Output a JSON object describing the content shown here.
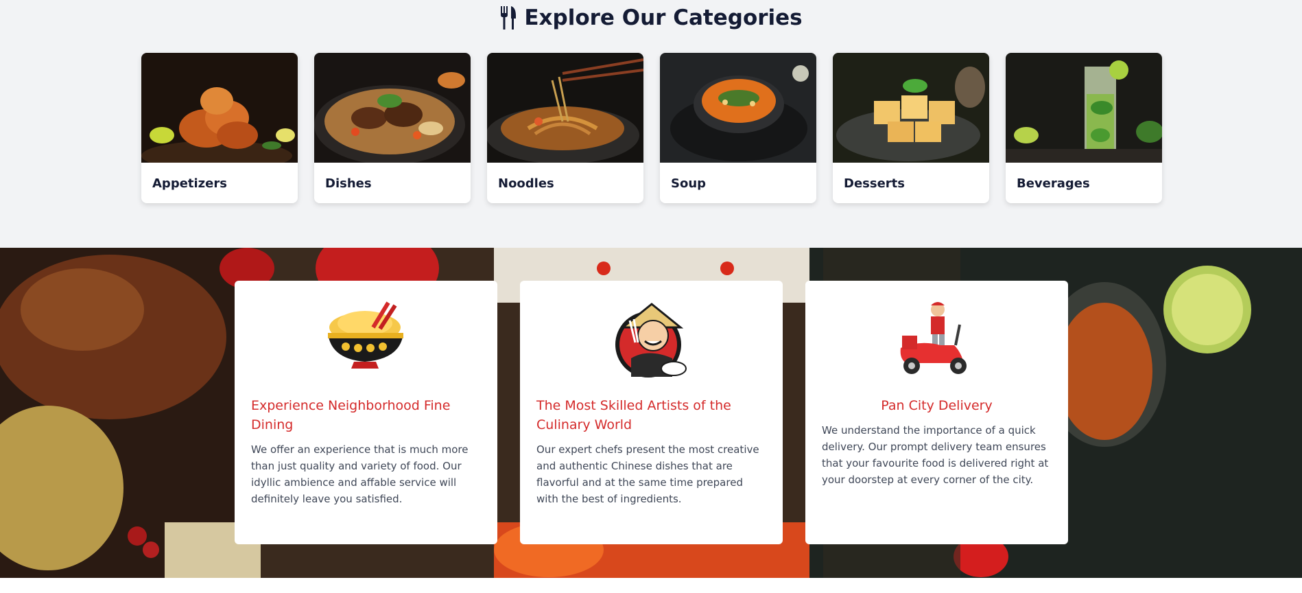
{
  "categories_section": {
    "title": "Explore Our Categories",
    "title_icon": "fork-knife-icon",
    "items": [
      {
        "label": "Appetizers",
        "image": "fried-shrimp-photo"
      },
      {
        "label": "Dishes",
        "image": "rice-dish-photo"
      },
      {
        "label": "Noodles",
        "image": "noodles-chopsticks-photo"
      },
      {
        "label": "Soup",
        "image": "soup-bowl-photo"
      },
      {
        "label": "Desserts",
        "image": "dessert-cubes-photo"
      },
      {
        "label": "Beverages",
        "image": "mojito-drink-photo"
      }
    ]
  },
  "features_section": {
    "background": "chinese-food-table-photo",
    "cards": [
      {
        "icon": "rice-bowl-chopsticks-icon",
        "title": "Experience Neighborhood Fine Dining",
        "description": "We offer an experience that is much more than just quality and variety of food. Our idyllic ambience and affable service will definitely leave you satisfied."
      },
      {
        "icon": "chef-mascot-icon",
        "title": "The Most Skilled Artists of the Culinary World",
        "description": "Our expert chefs present the most creative and authentic Chinese dishes that are flavorful and at the same time prepared with the best of ingredients."
      },
      {
        "icon": "delivery-scooter-icon",
        "title": "Pan City Delivery",
        "description": "We understand the importance of a quick delivery. Our prompt delivery team ensures that your favourite food is delivered right at your doorstep at every corner of the city."
      }
    ]
  },
  "colors": {
    "page_bg": "#f2f3f5",
    "heading": "#141b34",
    "accent_red": "#d42a2a",
    "body_text": "#3e4656"
  }
}
